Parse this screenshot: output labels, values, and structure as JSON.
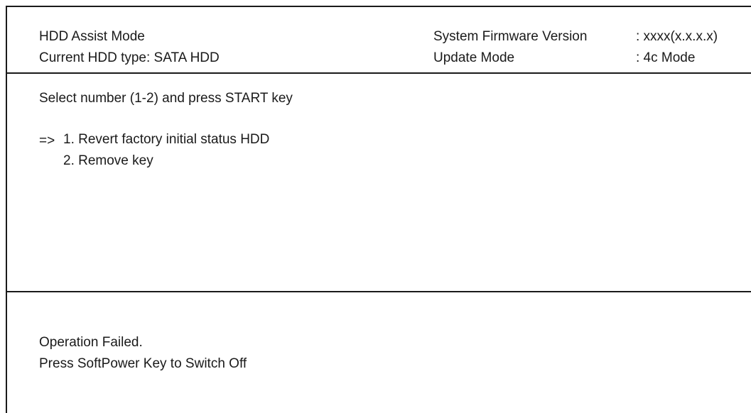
{
  "header": {
    "mode_title": "HDD Assist Mode",
    "hdd_type": "Current HDD type: SATA HDD",
    "firmware_label": "System Firmware Version",
    "firmware_value": ": xxxx(x.x.x.x)",
    "update_label": "Update Mode",
    "update_value": ": 4c Mode"
  },
  "menu": {
    "prompt": "Select number (1-2) and press START key",
    "cursor": "=>",
    "items": [
      {
        "label": "1. Revert factory initial status HDD",
        "selected": true
      },
      {
        "label": "2. Remove key",
        "selected": false
      }
    ]
  },
  "status": {
    "message": "Operation Failed.",
    "instruction": "Press SoftPower Key to Switch Off"
  }
}
